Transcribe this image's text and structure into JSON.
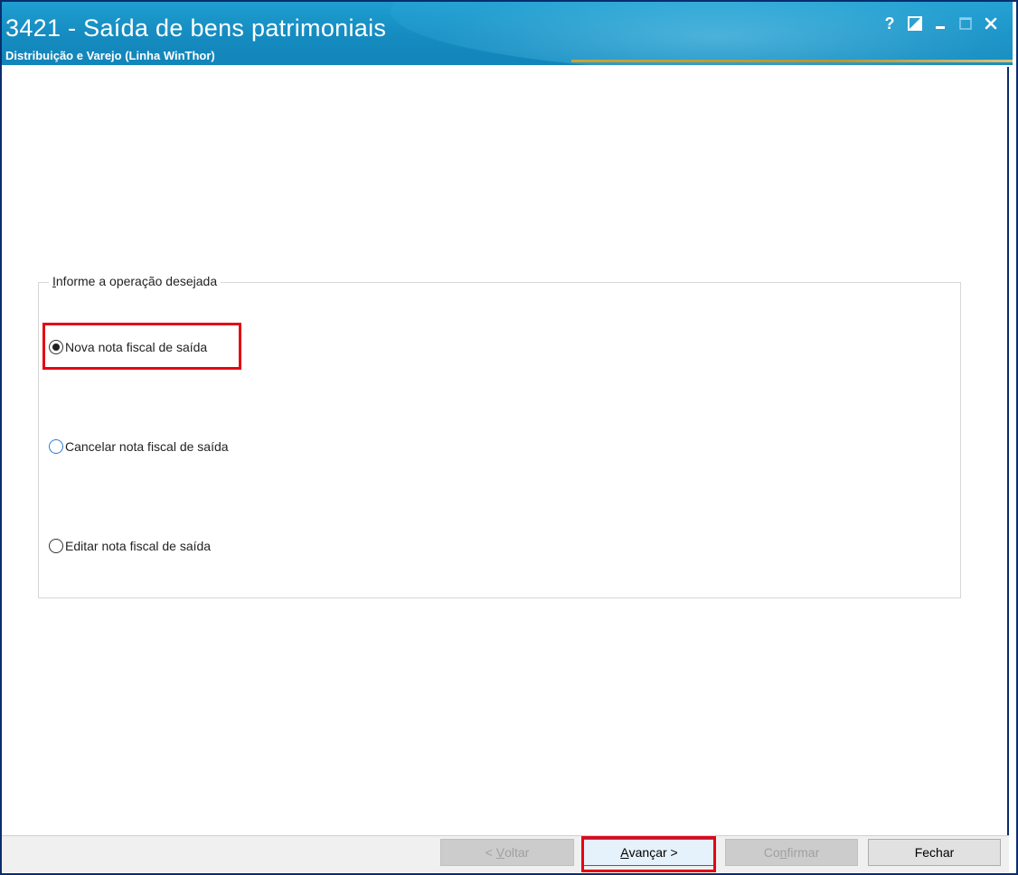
{
  "window": {
    "title": "3421 - Saída de bens patrimoniais",
    "subtitle": "Distribuição e Varejo (Linha WinThor)",
    "controls": {
      "help_label": "?",
      "theme_icon": "contrast-icon",
      "minimize_icon": "minimize-icon",
      "maximize_icon": "maximize-icon",
      "close_icon": "close-icon"
    },
    "colors": {
      "titlebar": "#158bc0",
      "frame": "#0a2d6e",
      "highlight": "#e30613"
    }
  },
  "operation_group": {
    "legend": "Informe a operação desejada",
    "options": [
      {
        "label": "Nova nota fiscal de saída",
        "selected": true
      },
      {
        "label": "Cancelar nota fiscal de saída",
        "selected": false
      },
      {
        "label": "Editar nota fiscal de saída",
        "selected": false
      }
    ]
  },
  "footer": {
    "back_label_prefix": "< ",
    "back_label_key": "V",
    "back_label_rest": "oltar",
    "next_label_key": "A",
    "next_label_rest": "vançar >",
    "confirm_label_prefix": "Co",
    "confirm_label_key": "n",
    "confirm_label_rest": "firmar",
    "close_label": "Fechar"
  }
}
